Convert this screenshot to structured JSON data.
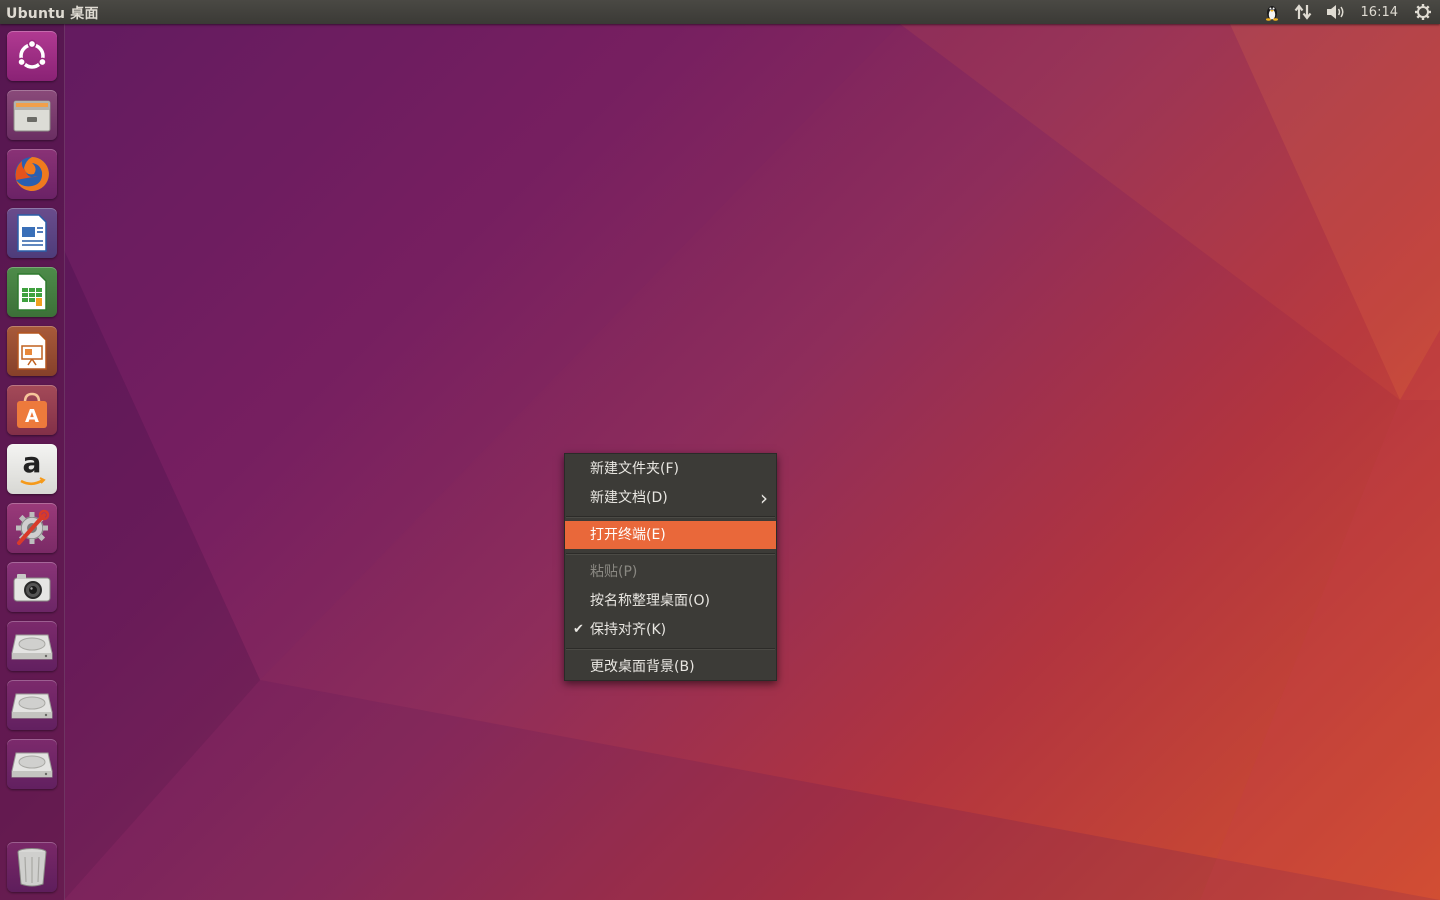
{
  "top_panel": {
    "title": "Ubuntu 桌面",
    "clock": "16:14",
    "indicators": [
      "tux-icon",
      "network-icon",
      "volume-icon",
      "power-gear-icon"
    ]
  },
  "launcher": {
    "items": [
      {
        "name": "ubuntu-dash-icon"
      },
      {
        "name": "files-icon"
      },
      {
        "name": "firefox-icon"
      },
      {
        "name": "libreoffice-writer-icon"
      },
      {
        "name": "libreoffice-calc-icon"
      },
      {
        "name": "libreoffice-impress-icon"
      },
      {
        "name": "software-center-icon"
      },
      {
        "name": "amazon-icon"
      },
      {
        "name": "system-settings-icon"
      },
      {
        "name": "camera-icon"
      },
      {
        "name": "drive-icon"
      },
      {
        "name": "drive-icon"
      },
      {
        "name": "drive-icon"
      },
      {
        "name": "trash-icon"
      }
    ],
    "amazon_letter": "a"
  },
  "context_menu": {
    "new_folder": "新建文件夹(F)",
    "new_document": "新建文档(D)",
    "submenu_arrow": "›",
    "open_terminal": "打开终端(E)",
    "paste": "粘贴(P)",
    "arrange_by_name": "按名称整理桌面(O)",
    "keep_aligned": "保持对齐(K)",
    "checkmark": "✔",
    "change_background": "更改桌面背景(B)"
  },
  "colors": {
    "menu_highlight": "#e9683a",
    "menu_bg": "#3c3b37",
    "panel_bg": "#3b3a36"
  }
}
